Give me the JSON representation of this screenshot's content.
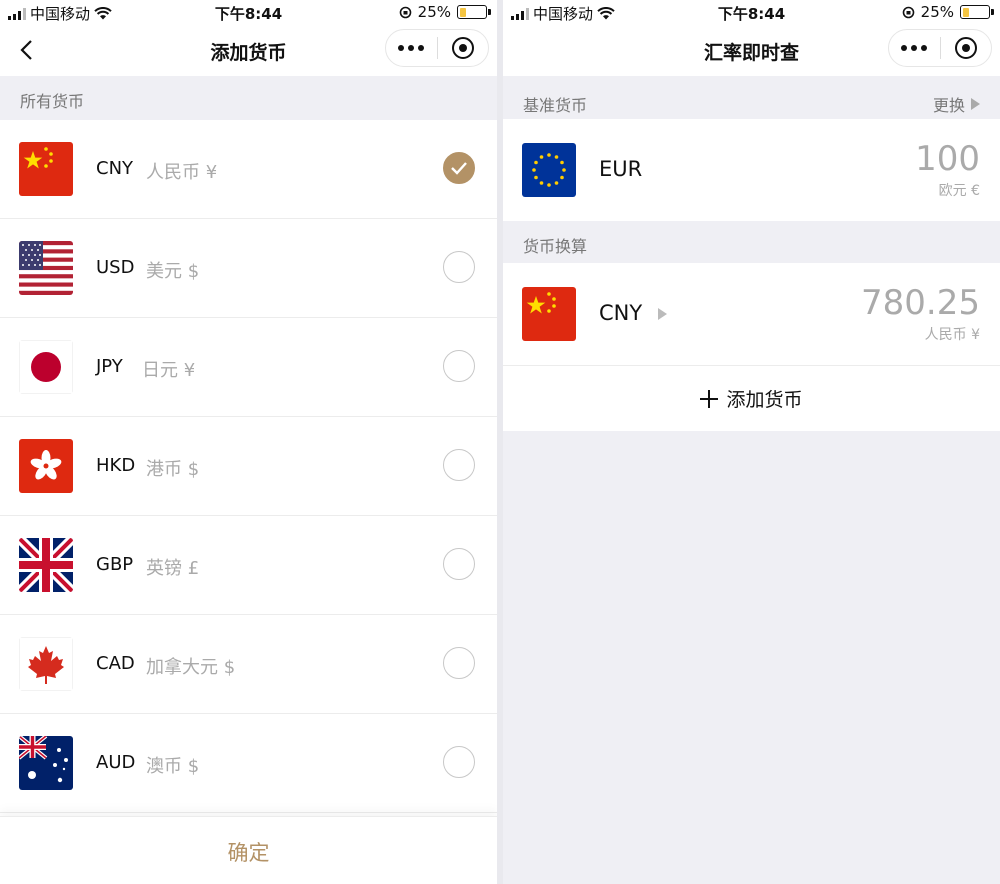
{
  "status_bar": {
    "carrier": "中国移动",
    "time": "下午8:44",
    "battery": "25%",
    "battery_level": 0.25
  },
  "left": {
    "nav_title": "添加货币",
    "section_title": "所有货币",
    "currencies": [
      {
        "code": "CNY",
        "name": "人民币 ¥",
        "flag": "china-flag",
        "selected": true
      },
      {
        "code": "USD",
        "name": "美元 $",
        "flag": "usa-flag",
        "selected": false
      },
      {
        "code": "JPY",
        "name": "日元 ¥",
        "flag": "japan-flag",
        "selected": false
      },
      {
        "code": "HKD",
        "name": "港币 $",
        "flag": "hong-kong-flag",
        "selected": false
      },
      {
        "code": "GBP",
        "name": "英镑 £",
        "flag": "uk-flag",
        "selected": false
      },
      {
        "code": "CAD",
        "name": "加拿大元 $",
        "flag": "canada-flag",
        "selected": false
      },
      {
        "code": "AUD",
        "name": "澳币 $",
        "flag": "australia-flag",
        "selected": false
      }
    ],
    "confirm_label": "确定"
  },
  "right": {
    "nav_title": "汇率即时查",
    "base_section": "基准货币",
    "change_label": "更换",
    "base": {
      "code": "EUR",
      "amount": "100",
      "subtitle": "欧元 €",
      "flag": "eu-flag"
    },
    "convert_section": "货币换算",
    "converted": {
      "code": "CNY",
      "amount": "780.25",
      "subtitle": "人民币 ¥",
      "flag": "china-flag"
    },
    "add_label": "添加货币"
  },
  "colors": {
    "accent": "#b39266",
    "background": "#efeff4"
  }
}
